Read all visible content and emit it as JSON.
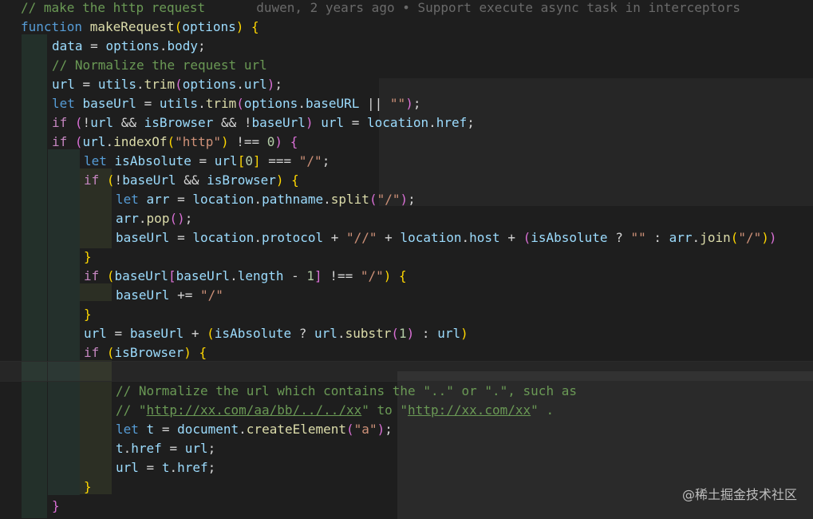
{
  "blame": {
    "text": "duwen, 2 years ago • Support execute async task in interceptors"
  },
  "watermark": {
    "text": "@稀土掘金技术社区"
  },
  "code": {
    "l0_comment": "// make the http request",
    "l1_kw": "function",
    "l1_fn": "makeRequest",
    "l1_param": "options",
    "l2_data": "data",
    "l2_opt": "options",
    "l2_body": "body",
    "l3_comment": "// Normalize the request url",
    "l4_url": "url",
    "l4_utils": "utils",
    "l4_trim": "trim",
    "l4_opt": "options",
    "l4_url2": "url",
    "l5_let": "let",
    "l5_baseUrl": "baseUrl",
    "l5_utils": "utils",
    "l5_trim": "trim",
    "l5_opt": "options",
    "l5_baseURL": "baseURL",
    "l5_str": "\"\"",
    "l6_if": "if",
    "l6_url": "url",
    "l6_isBrowser": "isBrowser",
    "l6_baseUrl": "baseUrl",
    "l6_url2": "url",
    "l6_location": "location",
    "l6_href": "href",
    "l7_if": "if",
    "l7_url": "url",
    "l7_indexOf": "indexOf",
    "l7_str": "\"http\"",
    "l7_num": "0",
    "l8_let": "let",
    "l8_isAbsolute": "isAbsolute",
    "l8_url": "url",
    "l8_num": "0",
    "l8_str": "\"/\"",
    "l9_if": "if",
    "l9_baseUrl": "baseUrl",
    "l9_isBrowser": "isBrowser",
    "l10_let": "let",
    "l10_arr": "arr",
    "l10_location": "location",
    "l10_pathname": "pathname",
    "l10_split": "split",
    "l10_str": "\"/\"",
    "l11_arr": "arr",
    "l11_pop": "pop",
    "l12_baseUrl": "baseUrl",
    "l12_location": "location",
    "l12_protocol": "protocol",
    "l12_str1": "\"//\"",
    "l12_location2": "location",
    "l12_host": "host",
    "l12_isAbsolute": "isAbsolute",
    "l12_str2": "\"\"",
    "l12_arr": "arr",
    "l12_join": "join",
    "l12_str3": "\"/\"",
    "l14_if": "if",
    "l14_baseUrl": "baseUrl",
    "l14_baseUrl2": "baseUrl",
    "l14_length": "length",
    "l14_num": "1",
    "l14_str": "\"/\"",
    "l15_baseUrl": "baseUrl",
    "l15_str": "\"/\"",
    "l17_url": "url",
    "l17_baseUrl": "baseUrl",
    "l17_isAbsolute": "isAbsolute",
    "l17_url2": "url",
    "l17_substr": "substr",
    "l17_num": "1",
    "l17_url3": "url",
    "l18_if": "if",
    "l18_isBrowser": "isBrowser",
    "l20_comment": "// Normalize the url which contains the \"..\" or \".\", such as",
    "l21_c1": "// \"",
    "l21_link1": "http://xx.com/aa/bb/../../xx",
    "l21_c2": "\" to \"",
    "l21_link2": "http://xx.com/xx",
    "l21_c3": "\" .",
    "l22_let": "let",
    "l22_t": "t",
    "l22_document": "document",
    "l22_createElement": "createElement",
    "l22_str": "\"a\"",
    "l23_t": "t",
    "l23_href": "href",
    "l23_url": "url",
    "l24_url": "url",
    "l24_t": "t",
    "l24_href": "href"
  }
}
